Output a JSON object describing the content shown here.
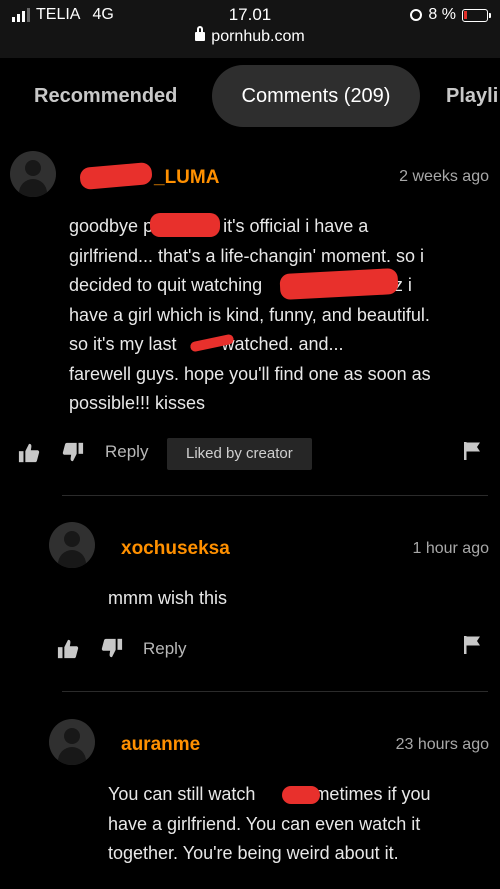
{
  "status_bar": {
    "carrier": "TELIA",
    "network": "4G",
    "time": "17.01",
    "url": "pornhub.com",
    "battery": "8 %"
  },
  "tabs": [
    {
      "label": "Recommended"
    },
    {
      "label": "Comments (209)"
    },
    {
      "label": "Playli"
    }
  ],
  "comments": [
    {
      "username": "_LUMA",
      "time": "2 weeks ago",
      "lines": [
        "goodbye p          o. it's official i have a",
        "girlfriend... that's a life-changin' moment. so i",
        "decided to quit watching                   y. cuz i",
        "have a girl which is kind, funny, and beautiful.",
        "so it's my last         watched. and...",
        "farewell guys. hope you'll find one as soon as",
        "possible!!! kisses"
      ],
      "reply_label": "Reply",
      "liked_label": "Liked by creator"
    },
    {
      "username": "xochuseksa",
      "time": "1 hour ago",
      "lines": [
        "mmm wish this"
      ],
      "reply_label": "Reply"
    },
    {
      "username": "auranme",
      "time": "23 hours ago",
      "lines": [
        "You can still watch        sometimes if you",
        "have a girlfriend. You can even watch it",
        "together. You're being weird about it."
      ]
    }
  ],
  "colors": {
    "username": "#ff9000",
    "background": "#000000",
    "redaction": "#e8302c"
  }
}
